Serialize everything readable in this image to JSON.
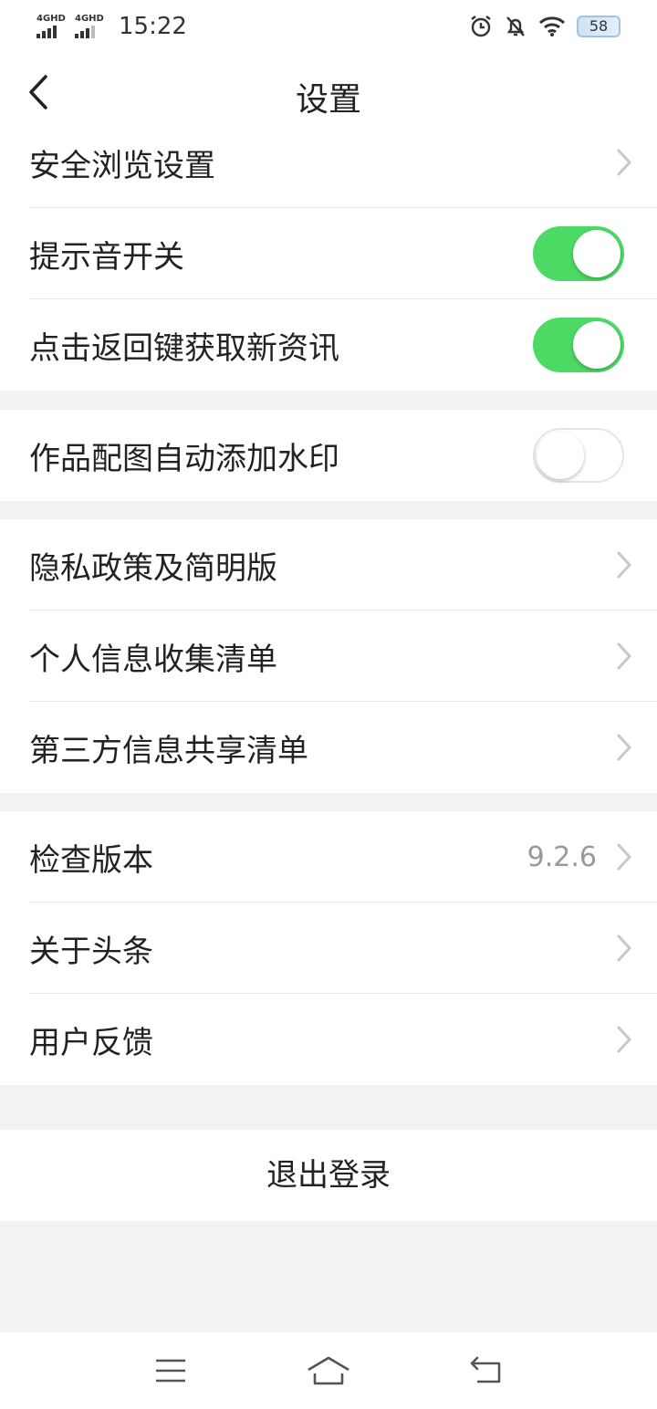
{
  "status_bar": {
    "signal1": "4GHD",
    "signal2": "4GHD",
    "time": "15:22",
    "battery": "58"
  },
  "header": {
    "title": "设置",
    "back_icon": "back-arrow-icon"
  },
  "groups": [
    {
      "items": [
        {
          "label": "安全浏览设置",
          "type": "link"
        },
        {
          "label": "提示音开关",
          "type": "toggle",
          "on": true
        },
        {
          "label": "点击返回键获取新资讯",
          "type": "toggle",
          "on": true
        }
      ]
    },
    {
      "items": [
        {
          "label": "作品配图自动添加水印",
          "type": "toggle",
          "on": false
        }
      ]
    },
    {
      "items": [
        {
          "label": "隐私政策及简明版",
          "type": "link"
        },
        {
          "label": "个人信息收集清单",
          "type": "link"
        },
        {
          "label": "第三方信息共享清单",
          "type": "link"
        }
      ]
    },
    {
      "items": [
        {
          "label": "检查版本",
          "type": "link",
          "value": "9.2.6"
        },
        {
          "label": "关于头条",
          "type": "link"
        },
        {
          "label": "用户反馈",
          "type": "link"
        }
      ]
    }
  ],
  "logout_label": "退出登录",
  "colors": {
    "toggle_on": "#4cd964",
    "background": "#f2f2f2"
  },
  "system_nav": {
    "menu_icon": "menu-icon",
    "home_icon": "home-icon",
    "back_icon": "back-icon"
  }
}
